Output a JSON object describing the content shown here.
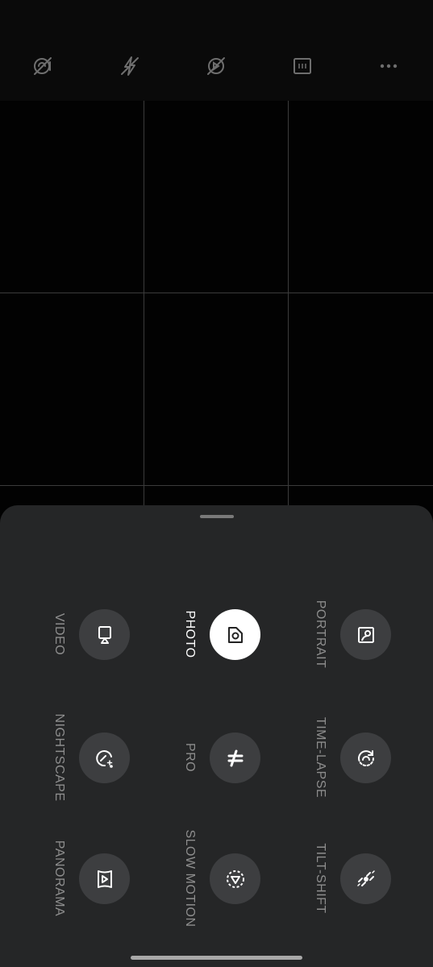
{
  "toolbar": {
    "buttons": [
      {
        "name": "hdr-off",
        "icon": "no-hdr-icon"
      },
      {
        "name": "flash-off",
        "icon": "flash-off-icon"
      },
      {
        "name": "live-photo-off",
        "icon": "no-motion-icon"
      },
      {
        "name": "aspect-ratio",
        "icon": "aspect-ratio-icon"
      },
      {
        "name": "more",
        "icon": "more-dots-icon"
      }
    ]
  },
  "modes": {
    "video": {
      "label": "VIDEO",
      "icon": "video-camera-icon"
    },
    "photo": {
      "label": "PHOTO",
      "icon": "camera-icon",
      "selected": true
    },
    "portrait": {
      "label": "PORTRAIT",
      "icon": "portrait-icon"
    },
    "nightscape": {
      "label": "NIGHTSCAPE",
      "icon": "nightscape-icon"
    },
    "pro": {
      "label": "PRO",
      "icon": "pro-mode-icon"
    },
    "timelapse": {
      "label": "TIME-LAPSE",
      "icon": "timelapse-icon"
    },
    "panorama": {
      "label": "PANORAMA",
      "icon": "panorama-icon"
    },
    "slow_motion": {
      "label": "SLOW MOTION",
      "icon": "slow-motion-icon"
    },
    "tilt_shift": {
      "label": "TILT-SHIFT",
      "icon": "tilt-shift-icon"
    }
  },
  "colors": {
    "sheet_background": "#252627",
    "mode_button": "#3d3e40",
    "selected_mode_button": "#ffffff",
    "label_inactive": "#8e8e8e",
    "label_active": "#ffffff"
  }
}
